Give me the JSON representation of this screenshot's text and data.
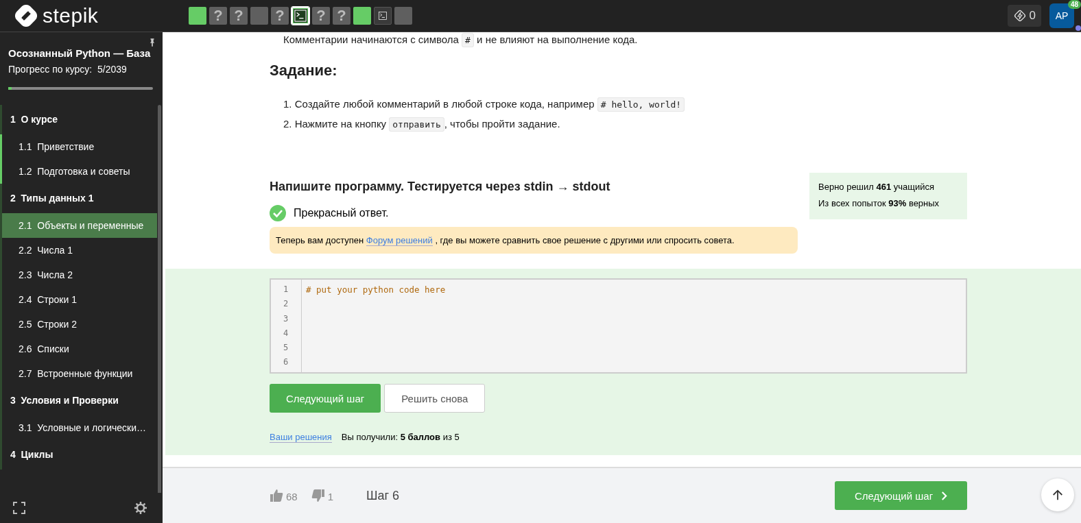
{
  "header": {
    "logo": "stepik",
    "steps": [
      {
        "kind": "text",
        "passed": true,
        "selected": false
      },
      {
        "kind": "quiz",
        "label": "?",
        "passed": false,
        "selected": false
      },
      {
        "kind": "quiz",
        "label": "?",
        "passed": false,
        "selected": false
      },
      {
        "kind": "text",
        "passed": false,
        "selected": false
      },
      {
        "kind": "quiz",
        "label": "?",
        "passed": false,
        "selected": false
      },
      {
        "kind": "code",
        "passed": true,
        "selected": true
      },
      {
        "kind": "quiz",
        "label": "?",
        "passed": false,
        "selected": false
      },
      {
        "kind": "quiz",
        "label": "?",
        "passed": false,
        "selected": false
      },
      {
        "kind": "text",
        "passed": true,
        "selected": false
      },
      {
        "kind": "code",
        "passed": false,
        "selected": false
      },
      {
        "kind": "text",
        "passed": false,
        "selected": false
      }
    ],
    "energy": "0",
    "avatar": "AP",
    "avatar_badge": "48"
  },
  "sidebar": {
    "course_title": "Осознанный Python — База",
    "progress_label": "Прогресс по курсу:  5/2039",
    "progress": {
      "level": 0.025
    },
    "sections": [
      {
        "title": "1  О курсе",
        "children": [
          {
            "title": "1.1  Приветствие",
            "passed": true,
            "selected": false
          },
          {
            "title": "1.2  Подготовка и советы",
            "passed": true,
            "selected": false
          }
        ]
      },
      {
        "title": "2  Типы данных 1",
        "children": [
          {
            "title": "2.1  Объекты и переменные",
            "passed": false,
            "selected": true
          },
          {
            "title": "2.2  Числа 1",
            "passed": false,
            "selected": false
          },
          {
            "title": "2.3  Числа 2",
            "passed": false,
            "selected": false
          },
          {
            "title": "2.4  Строки 1",
            "passed": false,
            "selected": false
          },
          {
            "title": "2.5  Строки 2",
            "passed": false,
            "selected": false
          },
          {
            "title": "2.6  Списки",
            "passed": false,
            "selected": false
          },
          {
            "title": "2.7  Встроенные функции",
            "passed": false,
            "selected": false
          }
        ]
      },
      {
        "title": "3  Условия и Проверки",
        "children": [
          {
            "title": "3.1  Условные и логически…",
            "passed": false,
            "selected": false
          }
        ]
      },
      {
        "title": "4  Циклы"
      }
    ]
  },
  "lesson": {
    "top_line": [
      "Комментарии начинаются с символа ",
      "#",
      " и не влияют на выполнение кода."
    ],
    "heading": "Задание:",
    "tasks": [
      {
        "number": "1.",
        "parts": [
          "Создайте любой комментарий в любой строке кода, например ",
          "# hello, world!"
        ]
      },
      {
        "number": "2.",
        "parts": [
          "Нажмите на кнопку ",
          "отправить",
          ", чтобы пройти задание."
        ]
      }
    ]
  },
  "problem": {
    "title": "Напишите программу. Тестируется через stdin → stdout",
    "result": "Прекрасный ответ.",
    "notice": [
      "Теперь вам доступен ",
      "Форум решений",
      " , где вы можете сравнить свое решение с другими или спросить совета."
    ],
    "stats": [
      "Верно решил **461** учащийся",
      "Из всех попыток **93%** верных"
    ],
    "editor": {
      "line_numbers": [
        "1",
        "2",
        "3",
        "4",
        "5",
        "6"
      ],
      "code": "# put your python code here"
    },
    "next_button": "Следующий шаг",
    "retry_button": "Решить снова",
    "solutions_link": "Ваши решения",
    "score": "Вы получили: **5 баллов** из 5"
  },
  "footer": {
    "likes": "68",
    "dislikes": "1",
    "step": "Шаг 6",
    "next_button": "Следующий шаг"
  }
}
